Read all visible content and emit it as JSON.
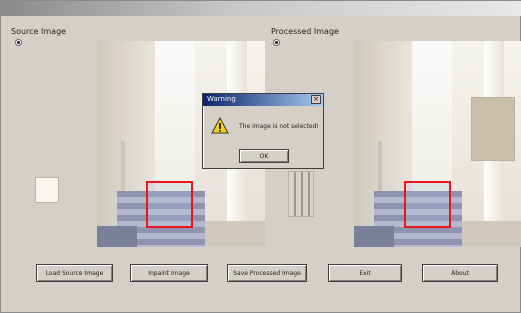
{
  "window": {
    "title": ""
  },
  "source": {
    "label": "Source Image",
    "radio_label": ""
  },
  "processed": {
    "label": "Processed Image",
    "radio_label": ""
  },
  "dialog": {
    "title": "Warning",
    "message": "The image is not selected!",
    "ok_label": "OK"
  },
  "buttons": [
    {
      "label": "Load Source Image"
    },
    {
      "label": "Inpaint Image"
    },
    {
      "label": "Save Processed Image"
    },
    {
      "label": "Exit"
    },
    {
      "label": "About"
    }
  ],
  "colors": {
    "selection": "#e8151c",
    "dialog_title": "#0a246a",
    "face": "#d4d0c8"
  }
}
